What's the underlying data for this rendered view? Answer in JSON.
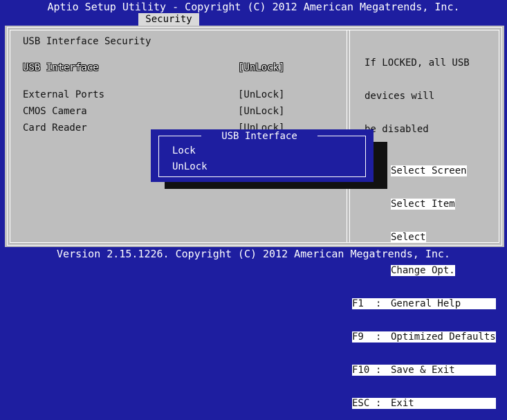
{
  "header": {
    "title": "Aptio Setup Utility - Copyright (C) 2012 American Megatrends, Inc.",
    "active_tab": "Security"
  },
  "main": {
    "section_title": "USB Interface Security",
    "items": [
      {
        "label": "USB Interface",
        "value": "[UnLock]",
        "selected": true
      },
      {
        "label": "External Ports",
        "value": "[UnLock]"
      },
      {
        "label": "CMOS Camera",
        "value": "[UnLock]"
      },
      {
        "label": "Card Reader",
        "value": "[UnLock]"
      }
    ]
  },
  "help": {
    "lines": [
      "If LOCKED, all USB",
      "devices will",
      "be disabled"
    ]
  },
  "keys": [
    {
      "key": "",
      "sep": "",
      "desc": "Select Screen"
    },
    {
      "key": "",
      "sep": "",
      "desc": "Select Item"
    },
    {
      "key": "",
      "sep": "",
      "desc": "Select"
    },
    {
      "key": "",
      "sep": "",
      "desc": "Change Opt."
    },
    {
      "key": "F1",
      "sep": ":",
      "desc": "General Help"
    },
    {
      "key": "F9",
      "sep": ":",
      "desc": "Optimized Defaults"
    },
    {
      "key": "F10",
      "sep": ":",
      "desc": "Save & Exit"
    },
    {
      "key": "ESC",
      "sep": ":",
      "desc": "Exit"
    }
  ],
  "dialog": {
    "title": "USB Interface",
    "options": [
      "Lock",
      "UnLock"
    ]
  },
  "footer": {
    "text": "Version 2.15.1226. Copyright (C) 2012 American Megatrends, Inc."
  },
  "colors": {
    "background": "#1e1ea0",
    "panel": "#bebebe",
    "text": "#111111",
    "highlight": "#ffffff"
  }
}
